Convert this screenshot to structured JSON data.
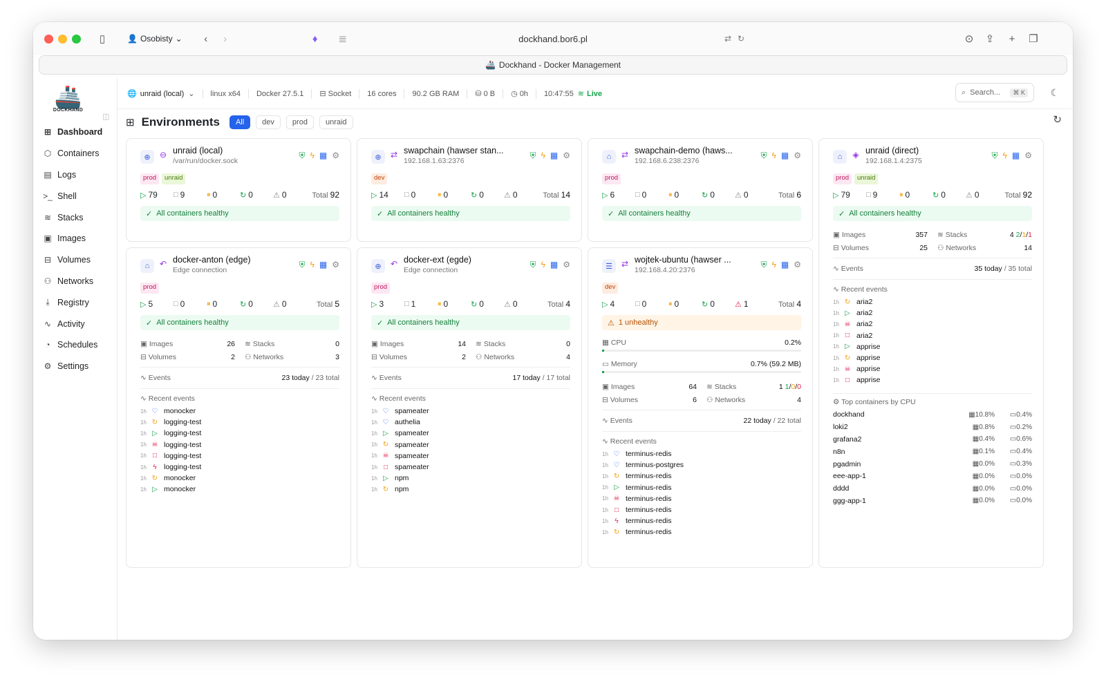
{
  "browser": {
    "profile": "Osobisty",
    "url": "dockhand.bor6.pl",
    "tab_title": "Dockhand - Docker Management"
  },
  "brand": "DOCKHAND",
  "nav": [
    {
      "label": "Dashboard",
      "icon": "grid-icon"
    },
    {
      "label": "Containers",
      "icon": "box-icon"
    },
    {
      "label": "Logs",
      "icon": "logs-icon"
    },
    {
      "label": "Shell",
      "icon": "terminal-icon"
    },
    {
      "label": "Stacks",
      "icon": "layers-icon"
    },
    {
      "label": "Images",
      "icon": "image-icon"
    },
    {
      "label": "Volumes",
      "icon": "drive-icon"
    },
    {
      "label": "Networks",
      "icon": "network-icon"
    },
    {
      "label": "Registry",
      "icon": "download-icon"
    },
    {
      "label": "Activity",
      "icon": "activity-icon"
    },
    {
      "label": "Schedules",
      "icon": "timer-icon"
    },
    {
      "label": "Settings",
      "icon": "gear-icon"
    }
  ],
  "topbar": {
    "env": "unraid (local)",
    "arch": "linux x64",
    "docker": "Docker 27.5.1",
    "conn": "Socket",
    "cores": "16 cores",
    "ram": "90.2 GB RAM",
    "disk": "0 B",
    "uptime": "0h",
    "time": "10:47:55",
    "live": "Live",
    "search": "Search...",
    "kbd": "⌘ K"
  },
  "header": {
    "title": "Environments",
    "filters": [
      "All",
      "dev",
      "prod",
      "unraid"
    ]
  },
  "cards": [
    {
      "name": "unraid (local)",
      "sub": "/var/run/docker.sock",
      "tags": [
        "prod",
        "unraid"
      ],
      "running": "79",
      "stopped": "9",
      "paused": "0",
      "restarting": "0",
      "unhealthy": "0",
      "total": "92",
      "health": "All containers healthy"
    },
    {
      "name": "swapchain (hawser stan...",
      "sub": "192.168.1.63:2376",
      "tags": [
        "dev"
      ],
      "running": "14",
      "stopped": "0",
      "paused": "0",
      "restarting": "0",
      "unhealthy": "0",
      "total": "14",
      "health": "All containers healthy"
    },
    {
      "name": "swapchain-demo (haws...",
      "sub": "192.168.6.238:2376",
      "tags": [
        "prod"
      ],
      "running": "6",
      "stopped": "0",
      "paused": "0",
      "restarting": "0",
      "unhealthy": "0",
      "total": "6",
      "health": "All containers healthy"
    },
    {
      "name": "unraid (direct)",
      "sub": "192.168.1.4:2375",
      "tags": [
        "prod",
        "unraid"
      ],
      "running": "79",
      "stopped": "9",
      "paused": "0",
      "restarting": "0",
      "unhealthy": "0",
      "total": "92",
      "health": "All containers healthy",
      "images": "357",
      "stacks": "4",
      "stacks_detail": [
        "2",
        "1",
        "1"
      ],
      "volumes": "25",
      "networks": "14",
      "events": "35 today",
      "events_total": "35 total",
      "recent": [
        [
          "restart",
          "aria2"
        ],
        [
          "play",
          "aria2"
        ],
        [
          "skull",
          "aria2"
        ],
        [
          "stop",
          "aria2"
        ],
        [
          "play",
          "apprise"
        ],
        [
          "restart",
          "apprise"
        ],
        [
          "skull",
          "apprise"
        ],
        [
          "stop",
          "apprise"
        ]
      ],
      "top_title": "Top containers by CPU",
      "top": [
        [
          "dockhand",
          "10.8%",
          "0.4%"
        ],
        [
          "loki2",
          "0.8%",
          "0.2%"
        ],
        [
          "grafana2",
          "0.4%",
          "0.6%"
        ],
        [
          "n8n",
          "0.1%",
          "0.4%"
        ],
        [
          "pgadmin",
          "0.0%",
          "0.3%"
        ],
        [
          "eee-app-1",
          "0.0%",
          "0.0%"
        ],
        [
          "dddd",
          "0.0%",
          "0.0%"
        ],
        [
          "ggg-app-1",
          "0.0%",
          "0.0%"
        ]
      ]
    },
    {
      "name": "docker-anton (edge)",
      "sub": "Edge connection",
      "tags": [
        "prod"
      ],
      "running": "5",
      "stopped": "0",
      "paused": "0",
      "restarting": "0",
      "unhealthy": "0",
      "total": "5",
      "health": "All containers healthy",
      "images": "26",
      "stacks": "0",
      "volumes": "2",
      "networks": "3",
      "events": "23 today",
      "events_total": "23 total",
      "recent": [
        [
          "heart",
          "monocker"
        ],
        [
          "restart",
          "logging-test"
        ],
        [
          "play",
          "logging-test"
        ],
        [
          "skull",
          "logging-test"
        ],
        [
          "stop",
          "logging-test"
        ],
        [
          "bolt",
          "logging-test"
        ],
        [
          "restart",
          "monocker"
        ],
        [
          "play",
          "monocker"
        ]
      ]
    },
    {
      "name": "docker-ext (egde)",
      "sub": "Edge connection",
      "tags": [
        "prod"
      ],
      "running": "3",
      "stopped": "1",
      "paused": "0",
      "restarting": "0",
      "unhealthy": "0",
      "total": "4",
      "health": "All containers healthy",
      "images": "14",
      "stacks": "0",
      "volumes": "2",
      "networks": "4",
      "events": "17 today",
      "events_total": "17 total",
      "recent": [
        [
          "heart",
          "spameater"
        ],
        [
          "heart",
          "authelia"
        ],
        [
          "play",
          "spameater"
        ],
        [
          "restart",
          "spameater"
        ],
        [
          "skull",
          "spameater"
        ],
        [
          "stop",
          "spameater"
        ],
        [
          "play",
          "npm"
        ],
        [
          "restart",
          "npm"
        ]
      ]
    },
    {
      "name": "wojtek-ubuntu (hawser ...",
      "sub": "192.168.4.20:2376",
      "tags": [
        "dev"
      ],
      "running": "4",
      "stopped": "0",
      "paused": "0",
      "restarting": "0",
      "unhealthy": "1",
      "total": "4",
      "health": "1 unhealthy",
      "cpu_label": "CPU",
      "cpu": "0.2%",
      "mem_label": "Memory",
      "mem": "0.7% (59.2 MB)",
      "images": "64",
      "stacks": "1",
      "stacks_detail": [
        "1",
        "0",
        "0"
      ],
      "volumes": "6",
      "networks": "4",
      "events": "22 today",
      "events_total": "22 total",
      "recent": [
        [
          "heart",
          "terminus-redis"
        ],
        [
          "heart",
          "terminus-postgres"
        ],
        [
          "restart",
          "terminus-redis"
        ],
        [
          "play",
          "terminus-redis"
        ],
        [
          "skull",
          "terminus-redis"
        ],
        [
          "stop",
          "terminus-redis"
        ],
        [
          "bolt",
          "terminus-redis"
        ],
        [
          "restart",
          "terminus-redis"
        ]
      ]
    }
  ],
  "labels": {
    "images": "Images",
    "stacks": "Stacks",
    "volumes": "Volumes",
    "networks": "Networks",
    "events": "Events",
    "recent": "Recent events",
    "total": "Total",
    "ago": "1h"
  }
}
